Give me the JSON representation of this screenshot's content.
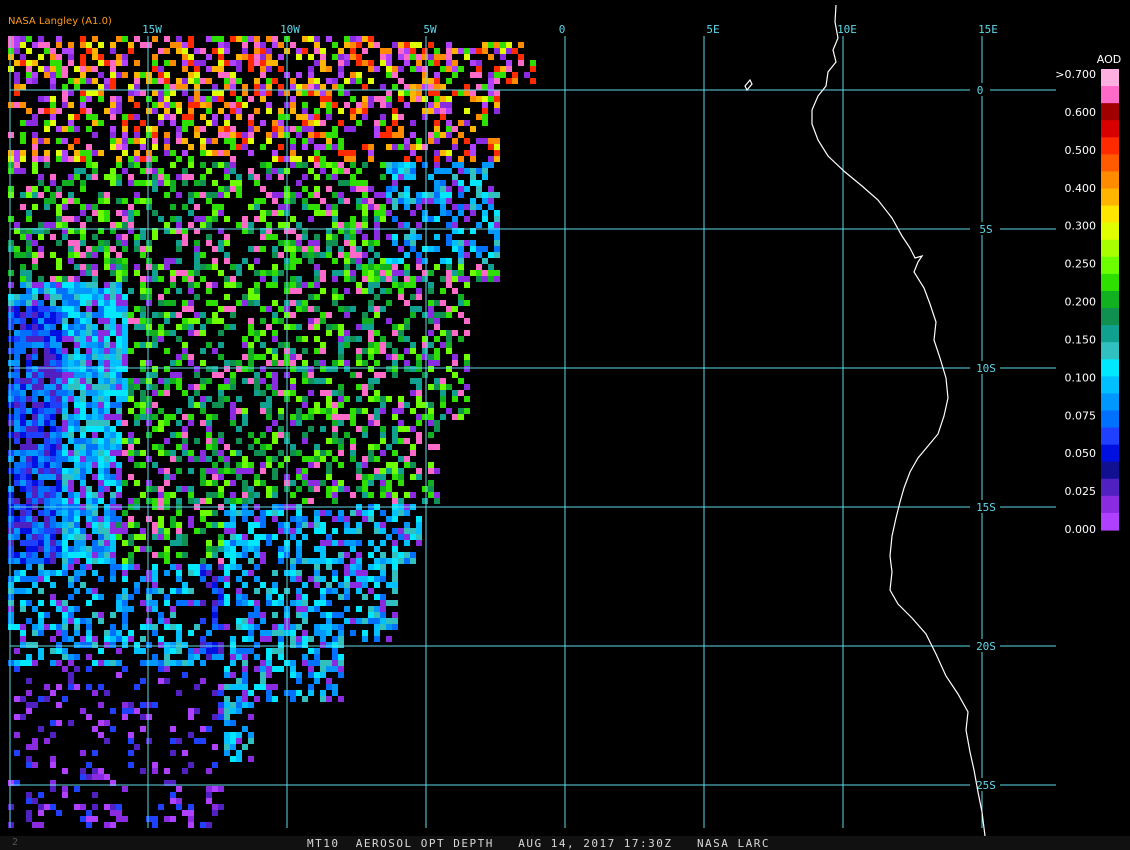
{
  "credit": "NASA Langley (A1.0)",
  "footer": {
    "frame_number": "2",
    "product": "MT10",
    "title": "AEROSOL OPT DEPTH",
    "datetime": "AUG 14, 2017 17:30Z",
    "source": "NASA LARC"
  },
  "grid": {
    "lon_labels": [
      "15W",
      "10W",
      "5W",
      "0",
      "5E",
      "10E",
      "15E"
    ],
    "lat_labels": [
      "0",
      "5S",
      "10S",
      "15S",
      "20S",
      "25S"
    ]
  },
  "legend": {
    "title": "AOD",
    "labels": [
      ">0.700",
      "0.600",
      "0.500",
      "0.400",
      "0.300",
      "0.250",
      "0.200",
      "0.150",
      "0.100",
      "0.075",
      "0.050",
      "0.025",
      "0.000"
    ],
    "colors": [
      "#ffb0e0",
      "#ff69c8",
      "#a00000",
      "#d80000",
      "#ff2a00",
      "#ff5a00",
      "#ff8c00",
      "#ffb400",
      "#ffe600",
      "#e0ff00",
      "#a8ff00",
      "#6cff00",
      "#2ee000",
      "#10b020",
      "#109050",
      "#10a090",
      "#30c0c0",
      "#00e8ff",
      "#00c0ff",
      "#0098ff",
      "#0070ff",
      "#2040ff",
      "#0010e0",
      "#101090",
      "#5020c0",
      "#8a2be2",
      "#b040ff"
    ]
  }
}
